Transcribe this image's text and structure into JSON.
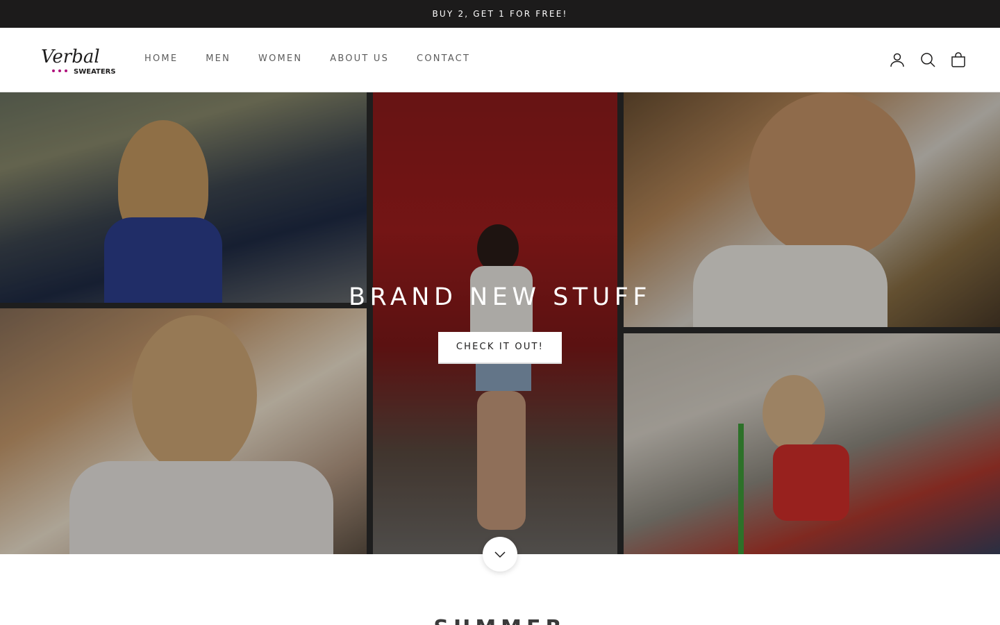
{
  "announcement": {
    "text": "BUY 2, GET 1 FOR FREE!"
  },
  "header": {
    "logo": {
      "line1": "Verbal",
      "line2": "SWEATERS",
      "dot_color": "#b0117b"
    },
    "nav": [
      {
        "label": "HOME"
      },
      {
        "label": "MEN"
      },
      {
        "label": "WOMEN"
      },
      {
        "label": "ABOUT US"
      },
      {
        "label": "CONTACT"
      }
    ],
    "icons": [
      "account-icon",
      "search-icon",
      "cart-icon"
    ]
  },
  "hero": {
    "title": "BRAND NEW STUFF",
    "button_label": "CHECK IT OUT!",
    "scroll_icon": "chevron-down-icon"
  },
  "next_section": {
    "title": "SUMMER"
  },
  "colors": {
    "bar": "#1c1b1b",
    "text": "#1c1b1b",
    "nav": "#5c5c5c"
  }
}
